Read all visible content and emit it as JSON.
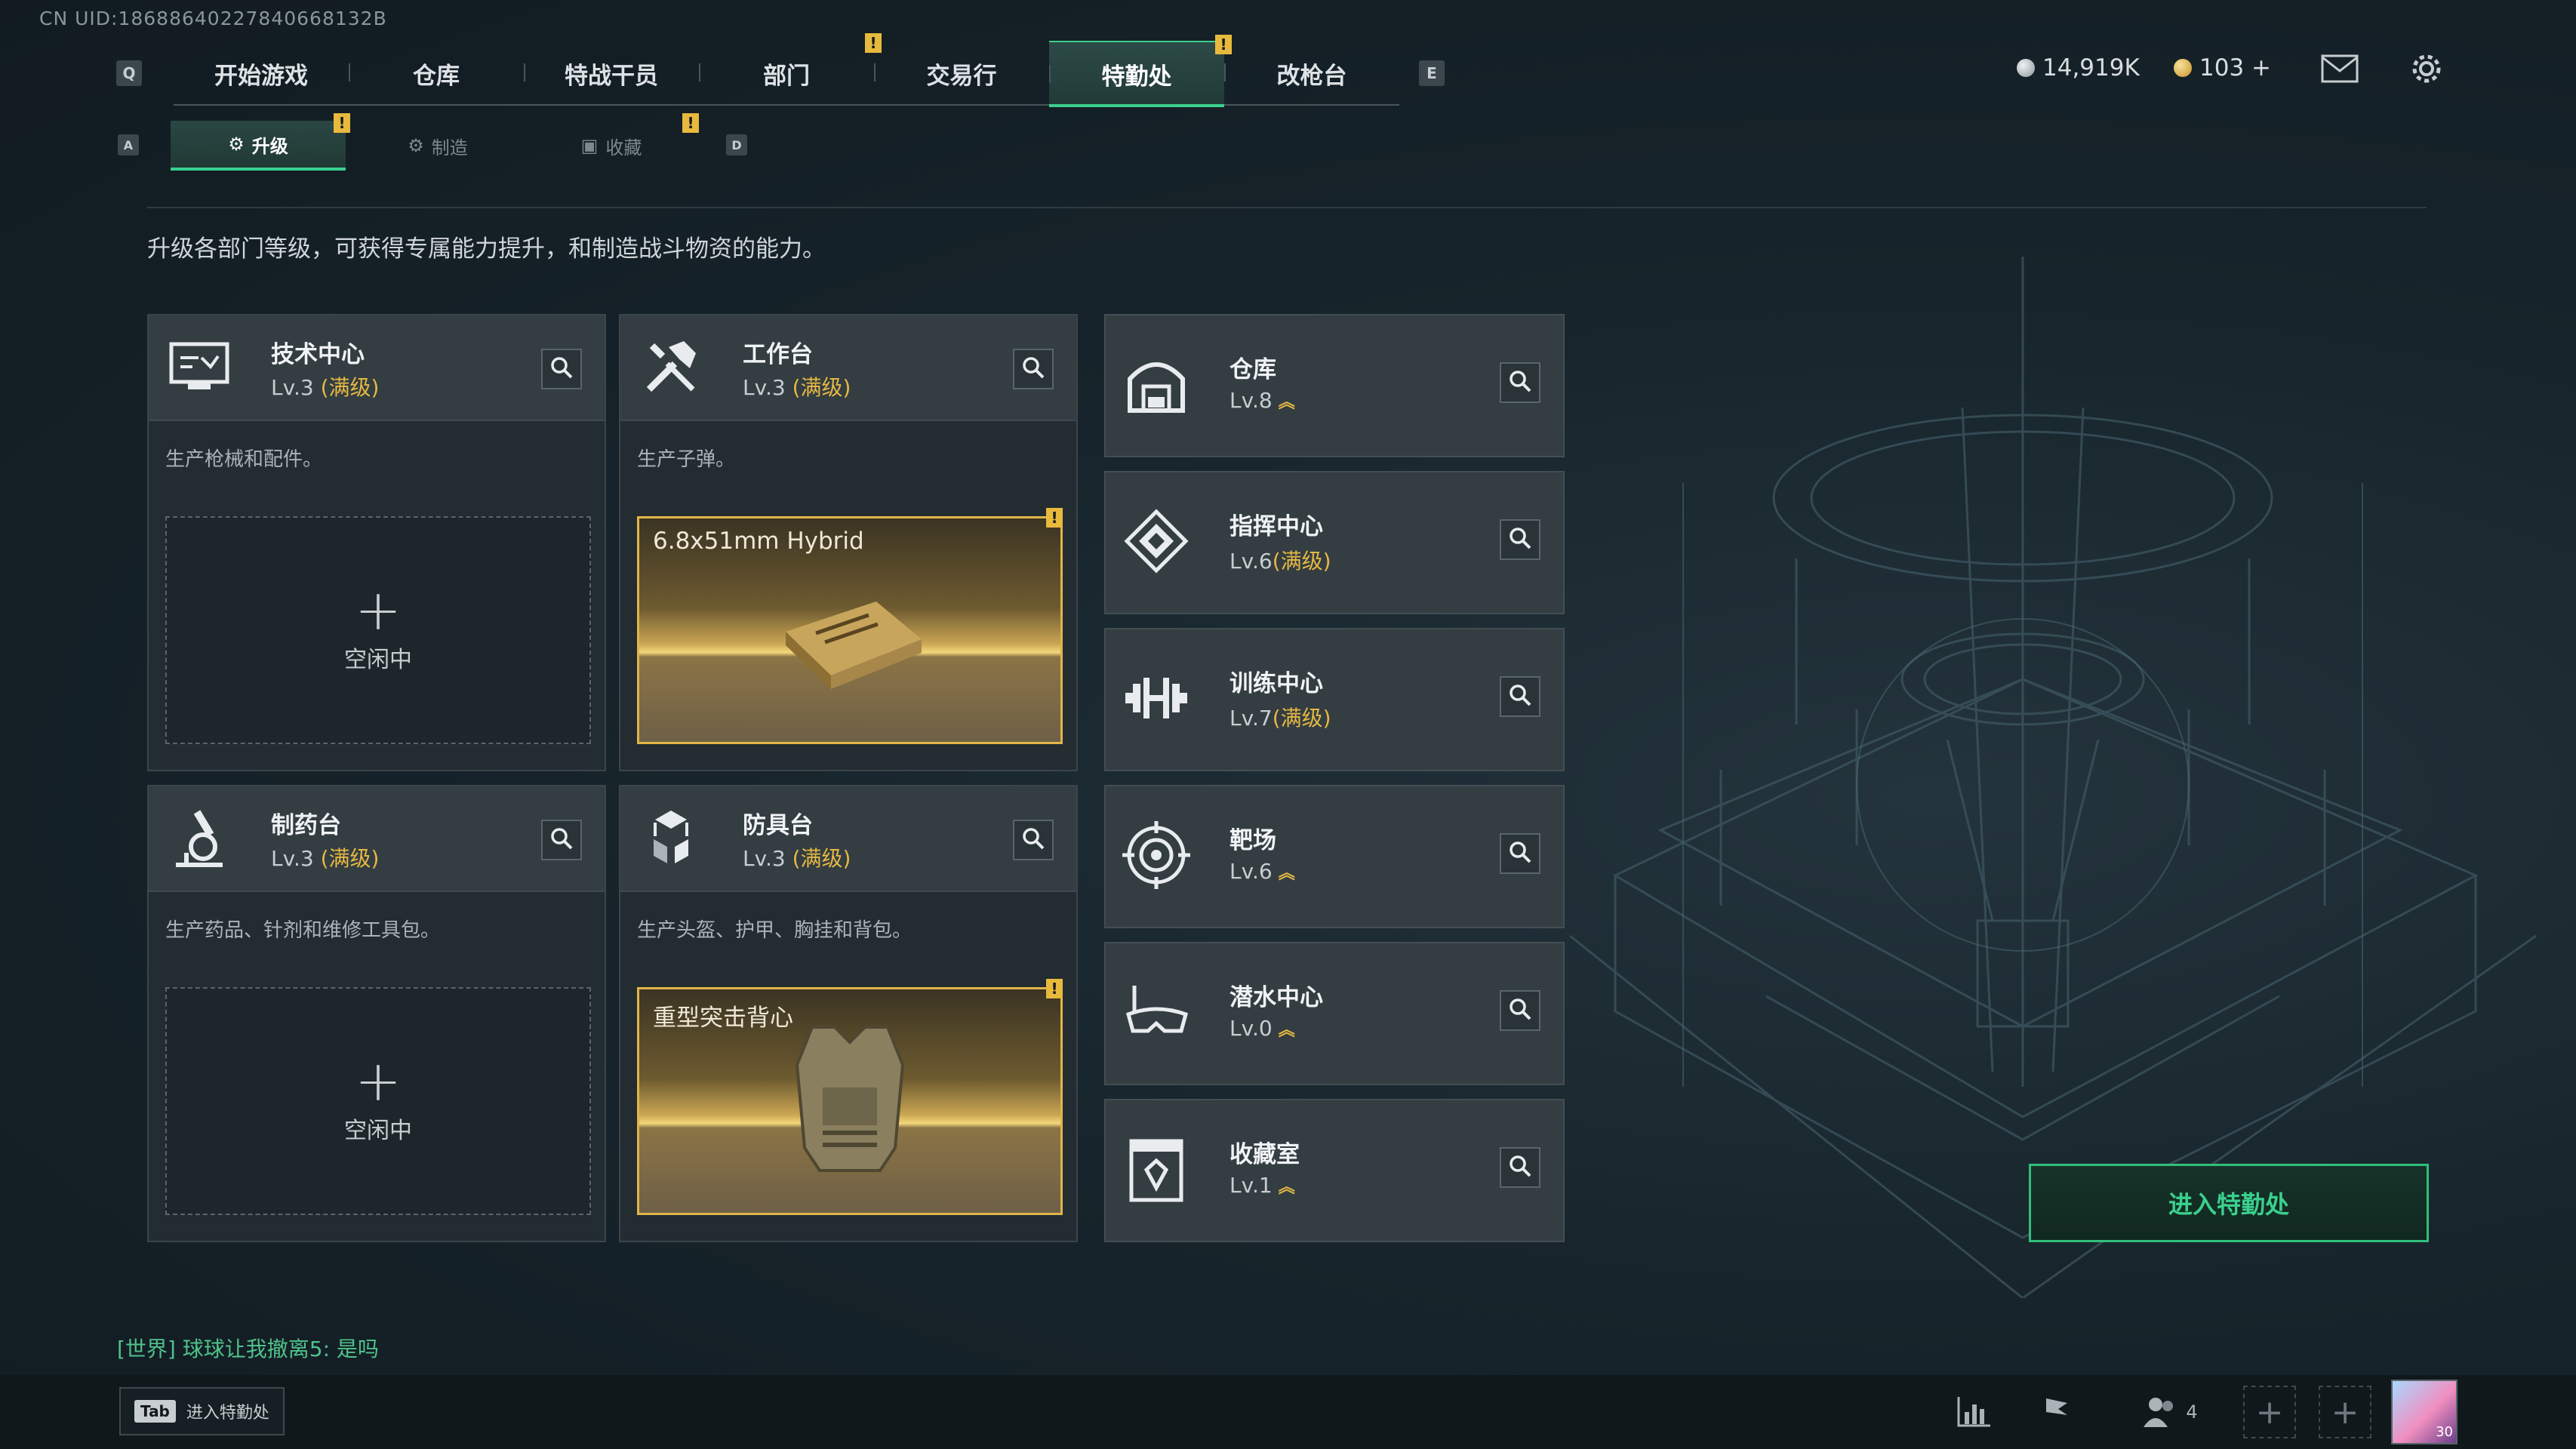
{
  "uid": "CN UID:18688640227840668132B",
  "nav": {
    "left_key": "Q",
    "right_key": "E",
    "tabs": [
      {
        "label": "开始游戏",
        "alert": false
      },
      {
        "label": "仓库",
        "alert": false
      },
      {
        "label": "特战干员",
        "alert": false
      },
      {
        "label": "部门",
        "alert": true
      },
      {
        "label": "交易行",
        "alert": false
      },
      {
        "label": "特勤处",
        "alert": true,
        "active": true
      },
      {
        "label": "改枪台",
        "alert": false
      }
    ],
    "alert_glyph": "!"
  },
  "currency": {
    "silver": "14,919K",
    "gold": "103 +"
  },
  "subnav": {
    "left_key": "A",
    "right_key": "D",
    "tabs": [
      {
        "label": "升级",
        "active": true,
        "alert": true
      },
      {
        "label": "制造",
        "active": false,
        "alert": false
      },
      {
        "label": "收藏",
        "active": false,
        "alert": true
      }
    ]
  },
  "intro": "升级各部门等级，可获得专属能力提升，和制造战斗物资的能力。",
  "departments": [
    {
      "name": "技术中心",
      "level": "Lv.3",
      "max": "(满级)",
      "desc": "生产枪械和配件。",
      "slot": {
        "state": "idle",
        "text": "空闲中",
        "plus": "+"
      }
    },
    {
      "name": "工作台",
      "level": "Lv.3",
      "max": "(满级)",
      "desc": "生产子弹。",
      "slot": {
        "state": "producing",
        "text": "6.8x51mm Hybrid"
      }
    },
    {
      "name": "制药台",
      "level": "Lv.3",
      "max": "(满级)",
      "desc": "生产药品、针剂和维修工具包。",
      "slot": {
        "state": "idle",
        "text": "空闲中",
        "plus": "+"
      }
    },
    {
      "name": "防具台",
      "level": "Lv.3",
      "max": "(满级)",
      "desc": "生产头盔、护甲、胸挂和背包。",
      "slot": {
        "state": "producing",
        "text": "重型突击背心"
      }
    }
  ],
  "facilities": [
    {
      "name": "仓库",
      "level": "Lv.8",
      "max": "",
      "upgradable": true
    },
    {
      "name": "指挥中心",
      "level": "Lv.6",
      "max": "(满级)",
      "upgradable": false
    },
    {
      "name": "训练中心",
      "level": "Lv.7",
      "max": "(满级)",
      "upgradable": false
    },
    {
      "name": "靶场",
      "level": "Lv.6",
      "max": "",
      "upgradable": true
    },
    {
      "name": "潜水中心",
      "level": "Lv.0",
      "max": "",
      "upgradable": true
    },
    {
      "name": "收藏室",
      "level": "Lv.1",
      "max": "",
      "upgradable": true
    }
  ],
  "upgrade_glyph": "︽",
  "enter_button": "进入特勤处",
  "chat": "[世界] 球球让我撤离5: 是吗",
  "tab_hint": {
    "key": "Tab",
    "label": "进入特勤处"
  },
  "friends_count": "4",
  "avatar_level": "30",
  "colors": {
    "accent_green": "#3ad08d",
    "alert_yellow": "#e7b93d",
    "max_level_gold": "#e6b843",
    "panel": "#333d42",
    "background": "#17242b"
  }
}
